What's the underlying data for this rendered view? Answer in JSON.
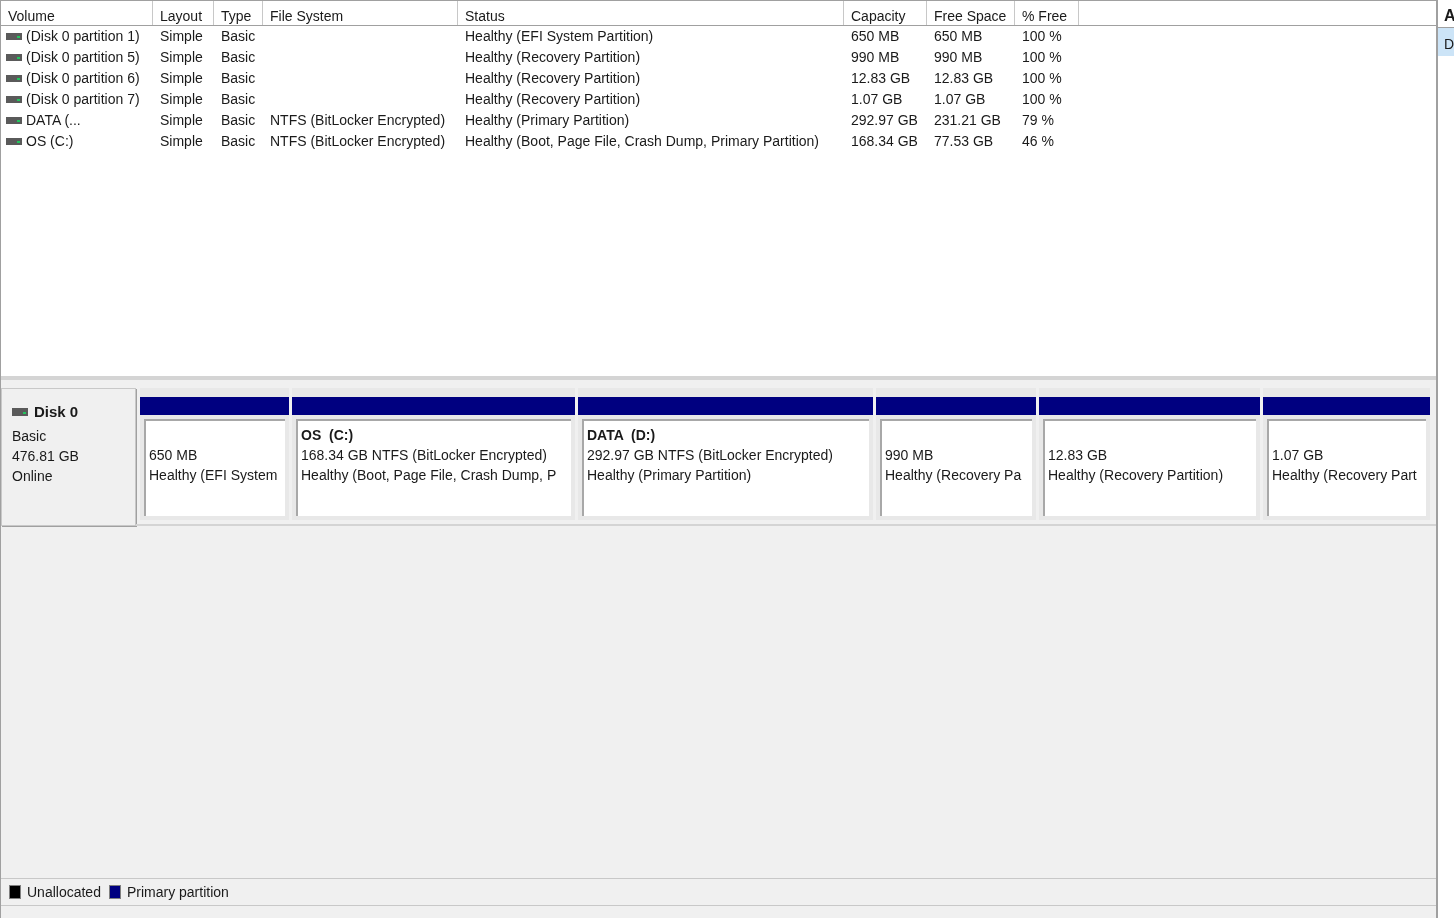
{
  "volume_list": {
    "columns": [
      "Volume",
      "Layout",
      "Type",
      "File System",
      "Status",
      "Capacity",
      "Free Space",
      "% Free"
    ],
    "rows": [
      {
        "cells": [
          "(Disk 0 partition 1)",
          "Simple",
          "Basic",
          "",
          "Healthy (EFI System Partition)",
          "650 MB",
          "650 MB",
          "100 %"
        ]
      },
      {
        "cells": [
          "(Disk 0 partition 5)",
          "Simple",
          "Basic",
          "",
          "Healthy (Recovery Partition)",
          "990 MB",
          "990 MB",
          "100 %"
        ]
      },
      {
        "cells": [
          "(Disk 0 partition 6)",
          "Simple",
          "Basic",
          "",
          "Healthy (Recovery Partition)",
          "12.83 GB",
          "12.83 GB",
          "100 %"
        ]
      },
      {
        "cells": [
          "(Disk 0 partition 7)",
          "Simple",
          "Basic",
          "",
          "Healthy (Recovery Partition)",
          "1.07 GB",
          "1.07 GB",
          "100 %"
        ]
      },
      {
        "cells": [
          "DATA (...",
          "Simple",
          "Basic",
          "NTFS (BitLocker Encrypted)",
          "Healthy (Primary Partition)",
          "292.97 GB",
          "231.21 GB",
          "79 %"
        ]
      },
      {
        "cells": [
          "OS (C:)",
          "Simple",
          "Basic",
          "NTFS (BitLocker Encrypted)",
          "Healthy (Boot, Page File, Crash Dump, Primary Partition)",
          "168.34 GB",
          "77.53 GB",
          "46 %"
        ]
      }
    ]
  },
  "disk": {
    "name": "Disk 0",
    "type": "Basic",
    "size": "476.81 GB",
    "status": "Online",
    "partitions": [
      {
        "size": "650 MB",
        "status": "Healthy (EFI System"
      },
      {
        "label": "OS  (C:)",
        "size": "168.34 GB NTFS (BitLocker Encrypted)",
        "status": "Healthy (Boot, Page File, Crash Dump, P"
      },
      {
        "label": "DATA  (D:)",
        "size": "292.97 GB NTFS (BitLocker Encrypted)",
        "status": "Healthy (Primary Partition)"
      },
      {
        "size": "990 MB",
        "status": "Healthy (Recovery Pa"
      },
      {
        "size": "12.83 GB",
        "status": "Healthy (Recovery Partition)"
      },
      {
        "size": "1.07 GB",
        "status": "Healthy (Recovery Part"
      }
    ]
  },
  "legend": [
    {
      "label": "Unallocated",
      "color": "#000000"
    },
    {
      "label": "Primary partition",
      "color": "#000080"
    }
  ],
  "side_panel": {
    "header": "A",
    "item": "D"
  }
}
